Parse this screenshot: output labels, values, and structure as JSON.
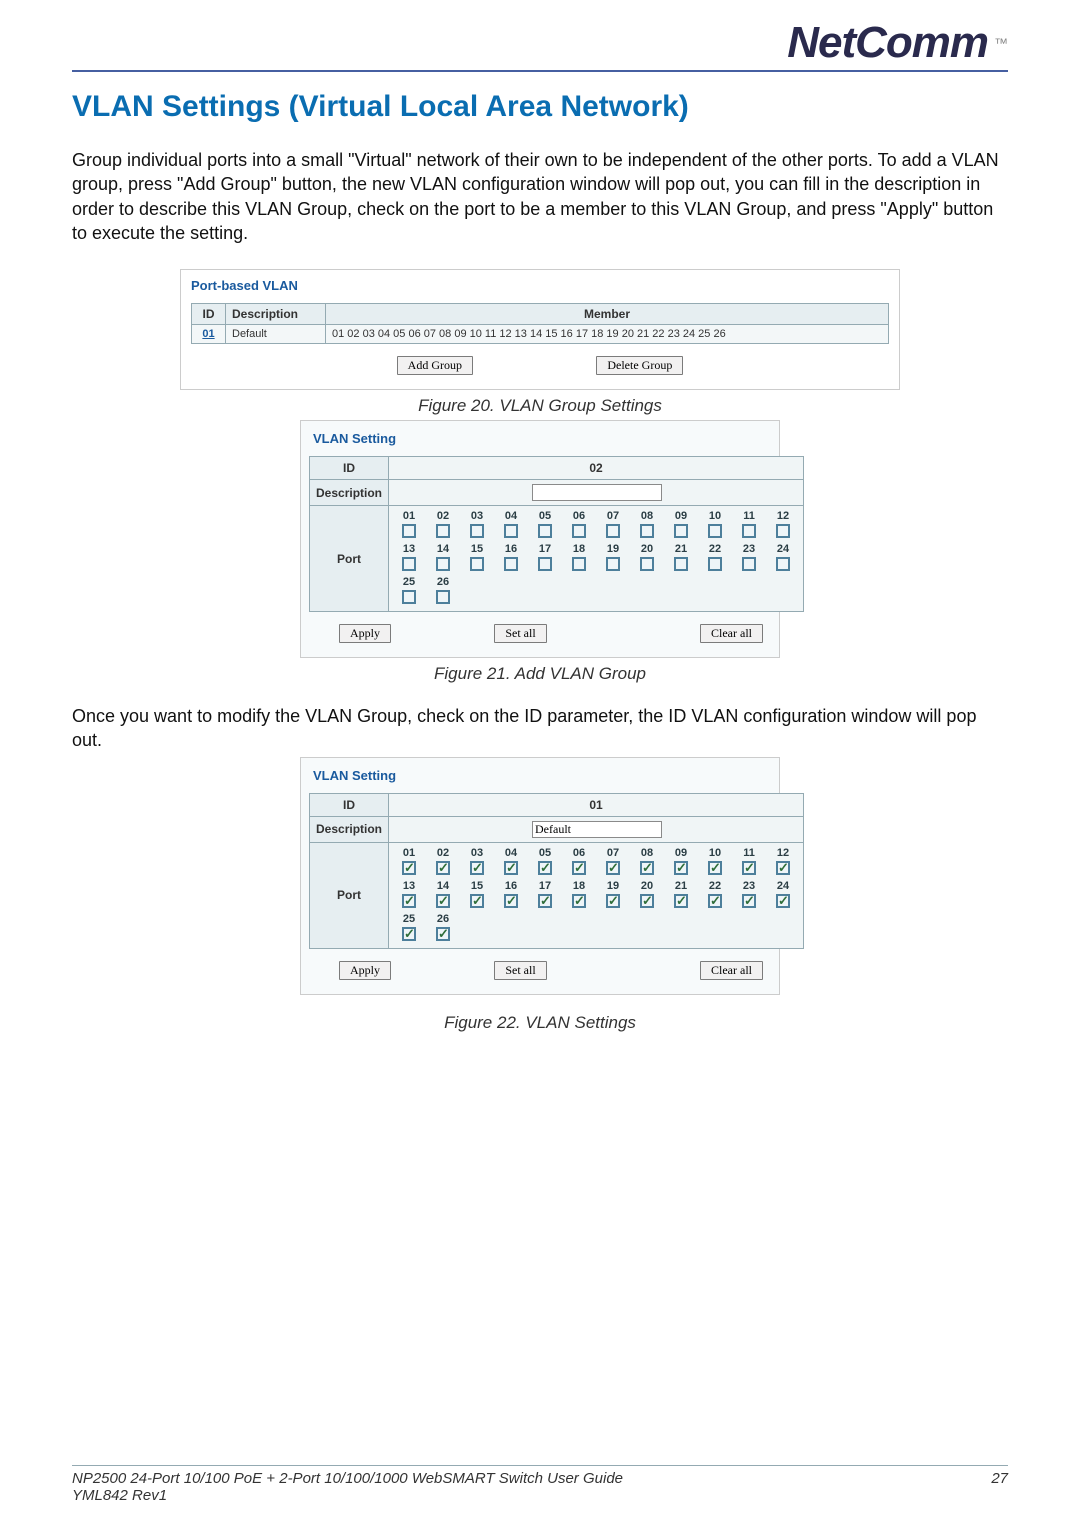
{
  "brand": "NetComm",
  "brand_tm": "™",
  "heading": "VLAN Settings (Virtual Local Area Network)",
  "intro": "Group individual ports into a small \"Virtual\" network of their own to be independent of the other ports. To add a VLAN group, press \"Add Group\" button, the new VLAN configuration window will pop out, you can fill in the description in order to describe this VLAN Group, check on the port to be a member to this VLAN Group, and press \"Apply\" button to execute the setting.",
  "fig20": {
    "heading": "Port-based VLAN",
    "th_id": "ID",
    "th_desc": "Description",
    "th_member": "Member",
    "row_id": "01",
    "row_desc": "Default",
    "row_members": "01 02 03 04 05 06 07 08 09 10 11 12 13 14 15 16 17 18 19 20 21 22 23 24 25 26",
    "btn_add": "Add Group",
    "btn_del": "Delete Group",
    "caption": "Figure 20. VLAN Group Settings"
  },
  "fig21": {
    "heading": "VLAN Setting",
    "row_id_label": "ID",
    "row_id_value": "02",
    "row_desc_label": "Description",
    "row_desc_value": "",
    "row_port_label": "Port",
    "port_numbers_r1": [
      "01",
      "02",
      "03",
      "04",
      "05",
      "06",
      "07",
      "08",
      "09",
      "10",
      "11",
      "12"
    ],
    "port_numbers_r2": [
      "13",
      "14",
      "15",
      "16",
      "17",
      "18",
      "19",
      "20",
      "21",
      "22",
      "23",
      "24"
    ],
    "port_numbers_r3": [
      "25",
      "26"
    ],
    "checked": false,
    "btn_apply": "Apply",
    "btn_setall": "Set all",
    "btn_clearall": "Clear all",
    "caption": "Figure 21. Add VLAN Group"
  },
  "para2": "Once you want to modify the VLAN Group, check on the ID parameter, the ID VLAN configuration window will pop out.",
  "fig22": {
    "heading": "VLAN Setting",
    "row_id_label": "ID",
    "row_id_value": "01",
    "row_desc_label": "Description",
    "row_desc_value": "Default",
    "row_port_label": "Port",
    "port_numbers_r1": [
      "01",
      "02",
      "03",
      "04",
      "05",
      "06",
      "07",
      "08",
      "09",
      "10",
      "11",
      "12"
    ],
    "port_numbers_r2": [
      "13",
      "14",
      "15",
      "16",
      "17",
      "18",
      "19",
      "20",
      "21",
      "22",
      "23",
      "24"
    ],
    "port_numbers_r3": [
      "25",
      "26"
    ],
    "checked": true,
    "btn_apply": "Apply",
    "btn_setall": "Set all",
    "btn_clearall": "Clear all",
    "caption": "Figure 22. VLAN Settings"
  },
  "footer": {
    "left_line1": "NP2500 24-Port 10/100 PoE + 2-Port 10/100/1000 WebSMART Switch User Guide",
    "left_line2": "YML842 Rev1",
    "page": "27"
  }
}
